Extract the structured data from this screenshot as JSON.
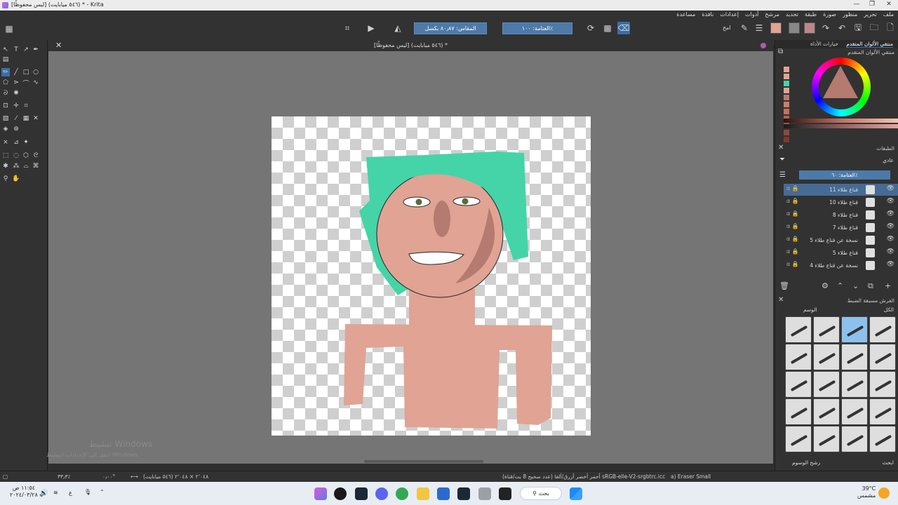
{
  "window": {
    "title": "[ليس محفوظًا] (٥٤٦ ميابايت) * - Krita"
  },
  "menu": [
    "ملف",
    "تحرير",
    "منظور",
    "صورة",
    "طبقة",
    "تحديد",
    "مرشح",
    "أدوات",
    "إعدادات",
    "نافذة",
    "مساعدة"
  ],
  "toolbar": {
    "scale_label": "المقاس: ٨٠٫٨٧ بكسل",
    "opacity_label": "العتامة: ١٠٠٪",
    "blend_label": "امح"
  },
  "document": {
    "tab_title": "[ليس محفوظًا] (٥٤٦ ميابايت) *"
  },
  "watermark": {
    "line1": "تنشيط Windows",
    "line2": "انتقل إلى الإعدادات لتنشيط Windows."
  },
  "dock": {
    "tab_advanced_color": "منتقي الألوان المتقدم",
    "tab_tool_options": "خيارات الأداة",
    "color_panel_title": "منتقي الألوان المتقدم",
    "layers_title": "الطبقات",
    "blend_mode": "عادي",
    "layers_opacity": "العتامة: ٦٠٪",
    "layers": [
      {
        "name": "قناع طلاء 11",
        "selected": true,
        "checked": true
      },
      {
        "name": "قناع طلاء 10"
      },
      {
        "name": "قناع طلاء 8"
      },
      {
        "name": "قناع طلاء 7"
      },
      {
        "name": "نسخة عن قناع طلاء 5"
      },
      {
        "name": "قناع طلاء 5"
      },
      {
        "name": "نسخة عن قناع طلاء 4"
      }
    ],
    "brushes_title": "الفرش مسبقة الضبط",
    "brush_filter": "الكل",
    "brush_tag_label": "الوسم",
    "brush_footer": "رشح الوسوم",
    "brush_search": "ابحث"
  },
  "statusbar": {
    "brush": "a) Eraser Small",
    "color_info": "أحمر أخضر أزرق/ألفا (عدد صحيح 8 بت/قناة) sRGB-elle-V2-srgbtrc.icc",
    "dimensions": "٢٬٠٤٨ × ٢٬٠٤٨ (٥٤٦ ميابايت)",
    "rotation": "٠٫٠٠°",
    "zoom": "٣٣٫٣٪"
  },
  "taskbar": {
    "time": "١١:٥٤ ص",
    "date": "٢٠٢٤/٠٣/٢٨",
    "weather_temp": "39°C",
    "weather_desc": "مشمس",
    "search_placeholder": "بحث",
    "lang": "ع"
  },
  "colors": {
    "accent": "#3b6ea5",
    "hair": "#44d4a8",
    "skin": "#e0a394",
    "nose": "#b57a70",
    "history": [
      "#e0a394",
      "#e0a394",
      "#44d4a8",
      "#e0a394",
      "#b57a70",
      "#d07a6a",
      "#c86e5c",
      "#b86050",
      "#a05848",
      "#904838",
      "#7a3a30"
    ]
  }
}
